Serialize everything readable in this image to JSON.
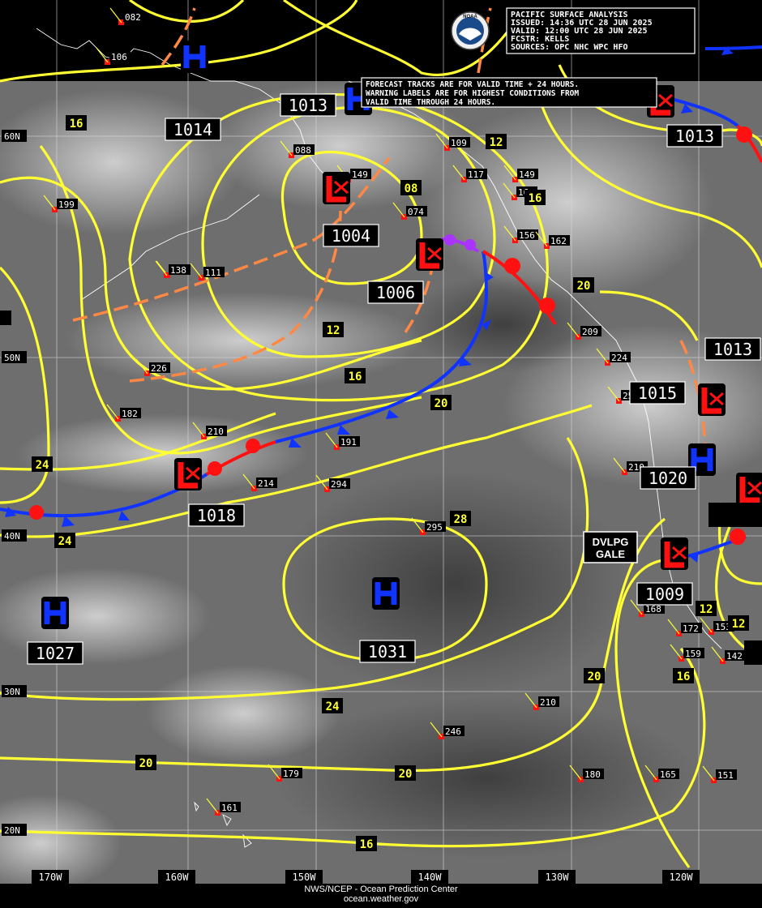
{
  "header": {
    "lines": [
      "PACIFIC SURFACE ANALYSIS",
      "ISSUED: 14:36 UTC 28 JUN 2025",
      "VALID:  12:00 UTC 28 JUN 2025",
      "FCSTR:  KELLS",
      "SOURCES: OPC NHC WPC HFO"
    ],
    "logo_text": "NOAA"
  },
  "notice": {
    "lines": [
      "FORECAST TRACKS ARE FOR VALID TIME + 24 HOURS.",
      "WARNING LABELS ARE FOR HIGHEST CONDITIONS FROM",
      "VALID TIME THROUGH 24 HOURS."
    ]
  },
  "footer": {
    "line1": "NWS/NCEP - Ocean Prediction Center",
    "line2": "ocean.weather.gov"
  },
  "lat_labels": [
    "60N",
    "50N",
    "40N",
    "30N",
    "20N"
  ],
  "lon_labels": [
    "170W",
    "160W",
    "150W",
    "140W",
    "130W",
    "120W"
  ],
  "pressure_centers": [
    {
      "type": "H",
      "value": ""
    },
    {
      "type": "H",
      "value": "1013"
    },
    {
      "type": "L",
      "value": "1004"
    },
    {
      "type": "L",
      "value": "1004"
    },
    {
      "type": "L",
      "value": "1006"
    },
    {
      "type": "L",
      "value": "1018"
    },
    {
      "type": "H",
      "value": "1031"
    },
    {
      "type": "H",
      "value": "1027"
    },
    {
      "type": "H",
      "value": "1020"
    },
    {
      "type": "L",
      "value": "1009"
    },
    {
      "type": "L",
      "value": "1013"
    },
    {
      "type": "L",
      "value": "1015"
    },
    {
      "type": "L",
      "value": ""
    }
  ],
  "isobar_labels": [
    {
      "text": "1014"
    },
    {
      "text": "1013"
    }
  ],
  "contour_labels": [
    "16",
    "12",
    "08",
    "16",
    "20",
    "12",
    "16",
    "20",
    "24",
    "24",
    "28",
    "24",
    "20",
    "20",
    "20",
    "16",
    "12",
    "12",
    "20",
    "16"
  ],
  "station_values": [
    "082",
    "106",
    "088",
    "109",
    "117",
    "149",
    "149",
    "16",
    "074",
    "156",
    "162",
    "138",
    "111",
    "199",
    "226",
    "182",
    "209",
    "224",
    "258",
    "210",
    "191",
    "214",
    "294",
    "210",
    "295",
    "168",
    "172",
    "153",
    "159",
    "142",
    "210",
    "246",
    "179",
    "180",
    "165",
    "151",
    "161",
    "138"
  ],
  "warning": {
    "line1": "DVLPG",
    "line2": "GALE"
  },
  "colors": {
    "isobar": "#ffff33",
    "cold_front": "#1133ff",
    "warm_front": "#ff1111",
    "occluded": "#aa33ff",
    "trough": "#ff8844",
    "high": "#1133ff",
    "low": "#ff1111"
  }
}
